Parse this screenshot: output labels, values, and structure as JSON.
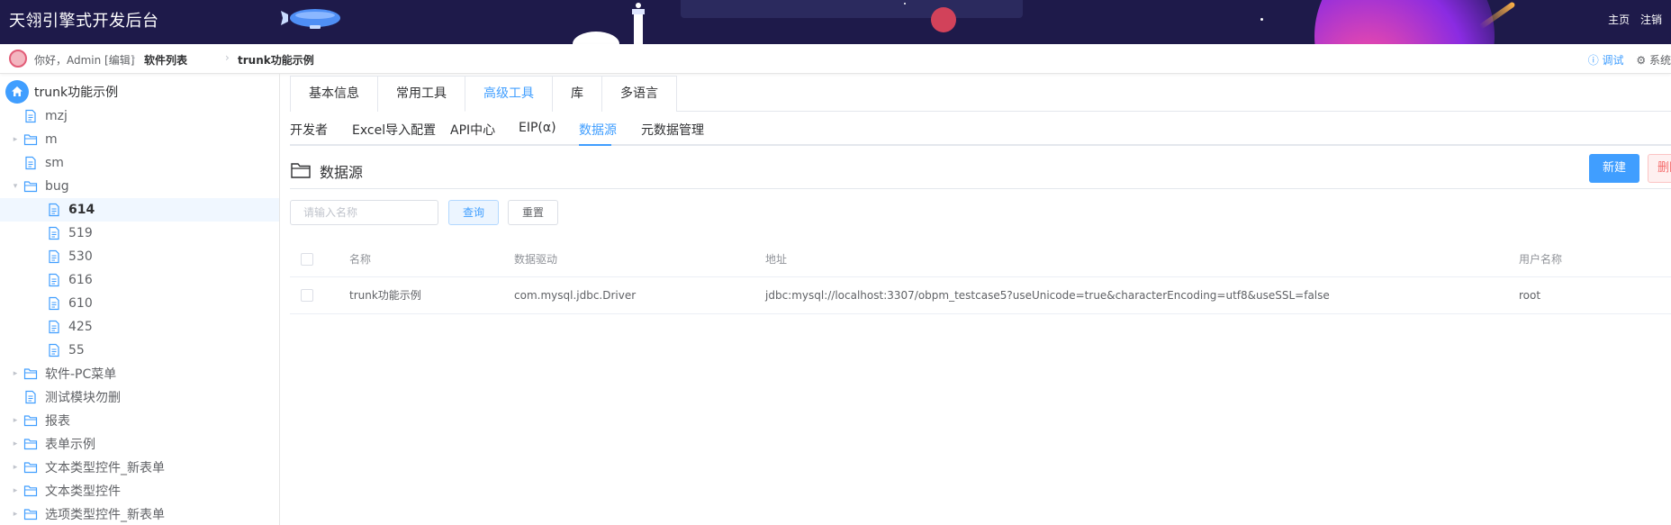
{
  "header": {
    "brand": "天翎引擎式开发后台",
    "home_link": "主页",
    "logout_link": "注销",
    "colors": {
      "background": "#1e1a4a"
    }
  },
  "crumbbar": {
    "greeting": "你好，Admin [编辑]",
    "crumbs": [
      "软件列表",
      "trunk功能示例"
    ],
    "debug_label": "调试",
    "system_label": "系统"
  },
  "sidebar": {
    "root_label": "trunk功能示例",
    "items": [
      {
        "label": "mzj",
        "type": "file",
        "level": 1
      },
      {
        "label": "m",
        "type": "folder",
        "level": 1,
        "expanded": false
      },
      {
        "label": "sm",
        "type": "file",
        "level": 1
      },
      {
        "label": "bug",
        "type": "folder",
        "level": 1,
        "expanded": true
      },
      {
        "label": "614",
        "type": "file",
        "level": 2,
        "selected": true
      },
      {
        "label": "519",
        "type": "file",
        "level": 2
      },
      {
        "label": "530",
        "type": "file",
        "level": 2
      },
      {
        "label": "616",
        "type": "file",
        "level": 2
      },
      {
        "label": "610",
        "type": "file",
        "level": 2
      },
      {
        "label": "425",
        "type": "file",
        "level": 2
      },
      {
        "label": "55",
        "type": "file",
        "level": 2
      },
      {
        "label": "软件-PC菜单",
        "type": "folder",
        "level": 1,
        "expanded": false
      },
      {
        "label": "测试模块勿删",
        "type": "file",
        "level": 1
      },
      {
        "label": "报表",
        "type": "folder",
        "level": 1,
        "expanded": false
      },
      {
        "label": "表单示例",
        "type": "folder",
        "level": 1,
        "expanded": false
      },
      {
        "label": "文本类型控件_新表单",
        "type": "folder",
        "level": 1,
        "expanded": false
      },
      {
        "label": "文本类型控件",
        "type": "folder",
        "level": 1,
        "expanded": false
      },
      {
        "label": "选项类型控件_新表单",
        "type": "folder",
        "level": 1,
        "expanded": false
      }
    ]
  },
  "main": {
    "tabs": [
      {
        "label": "基本信息",
        "active": false
      },
      {
        "label": "常用工具",
        "active": false
      },
      {
        "label": "高级工具",
        "active": true
      },
      {
        "label": "库",
        "active": false
      },
      {
        "label": "多语言",
        "active": false
      }
    ],
    "subtabs": [
      {
        "label": "开发者",
        "active": false
      },
      {
        "label": "Excel导入配置",
        "active": false
      },
      {
        "label": "API中心",
        "active": false
      },
      {
        "label": "EIP(α)",
        "active": false
      },
      {
        "label": "数据源",
        "active": true
      },
      {
        "label": "元数据管理",
        "active": false
      }
    ],
    "section_title": "数据源",
    "new_button": "新建",
    "delete_button": "删除",
    "search": {
      "placeholder": "请输入名称",
      "value": ""
    },
    "query_button": "查询",
    "reset_button": "重置",
    "table": {
      "columns": [
        "名称",
        "数据驱动",
        "地址",
        "用户名称"
      ],
      "rows": [
        [
          "trunk功能示例",
          "com.mysql.jdbc.Driver",
          "jdbc:mysql://localhost:3307/obpm_testcase5?useUnicode=true&characterEncoding=utf8&useSSL=false",
          "root"
        ]
      ]
    },
    "colors": {
      "accent": "#409eff",
      "danger": "#f56c6c"
    }
  }
}
